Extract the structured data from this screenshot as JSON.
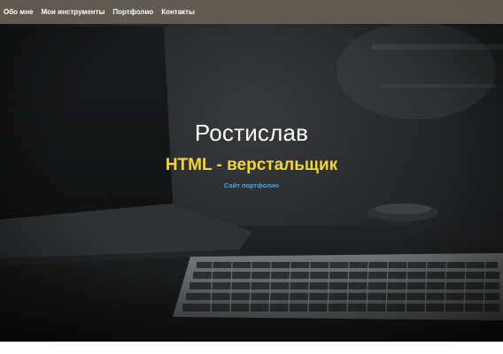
{
  "nav": {
    "items": [
      {
        "label": "Обо мне"
      },
      {
        "label": "Мои инструменты"
      },
      {
        "label": "Портфолио"
      },
      {
        "label": "Контакты"
      }
    ]
  },
  "hero": {
    "name": "Ростислав",
    "role": "HTML - верстальщик",
    "link": "Сайт портфолио"
  },
  "colors": {
    "accent": "#f5d530",
    "link": "#4aa3e0",
    "nav_bg": "#6c645a"
  }
}
